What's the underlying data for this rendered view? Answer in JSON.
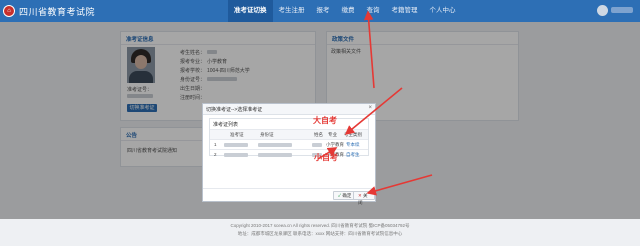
{
  "header": {
    "logo_mark": "⌂",
    "site_title": "四川省教育考试院",
    "nav": [
      {
        "label": "准考证切换",
        "active": true
      },
      {
        "label": "考生注册"
      },
      {
        "label": "报考"
      },
      {
        "label": "缴费"
      },
      {
        "label": "查询"
      },
      {
        "label": "考籍管理"
      },
      {
        "label": "个人中心"
      }
    ]
  },
  "info_panel": {
    "title": "准考证信息",
    "fields": [
      {
        "label": "考生姓名："
      },
      {
        "label": "报考专业：",
        "value": "小学教育"
      },
      {
        "label": "报考学校：",
        "value": "1004-四川师范大学"
      },
      {
        "label": "身份证号："
      },
      {
        "label": "出生日期："
      },
      {
        "label": "注册时间："
      }
    ],
    "exam_no_label": "准考证号：",
    "switch_button": "切换准考证"
  },
  "files_panel": {
    "title": "政策文件",
    "item": "政策相关文件"
  },
  "notice_panel": {
    "title": "公告",
    "item": "四川省教育考试院通知"
  },
  "modal": {
    "title": "切换准考证-->选择准考证",
    "close": "×",
    "list_title": "准考证列表",
    "columns": [
      "",
      "准考证",
      "身份证",
      "姓名",
      "专业",
      "考生类别"
    ],
    "rows": [
      {
        "index": "1",
        "major": "小学教育",
        "category": "专本续"
      },
      {
        "index": "2",
        "major": "小学教育",
        "category": "自考生"
      }
    ],
    "confirm_label": "确定",
    "cancel_label": "关闭"
  },
  "annotations": {
    "big": "大自考",
    "small": "小自考"
  },
  "footer": {
    "copyright": "Copyright 2010-2017 sceea.cn All rights reserved. 四川省教育考试院 蜀ICP备05034792号",
    "address": "地址：成都市城区龙泉驿区 联系电话：xxxx 网站支持：四川省教育考试院信息中心"
  },
  "colors": {
    "header": "#2d6fb5",
    "annotation": "#e53935"
  }
}
